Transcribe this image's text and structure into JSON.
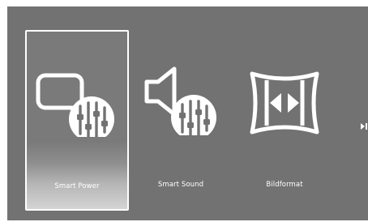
{
  "menu": {
    "items": [
      {
        "label": "Smart Power",
        "icon": "smart-power-icon",
        "selected": true
      },
      {
        "label": "Smart Sound",
        "icon": "smart-sound-icon",
        "selected": false
      },
      {
        "label": "Bildformat",
        "icon": "picture-format-icon",
        "selected": false
      }
    ],
    "next_icon": "next-arrow-icon"
  },
  "colors": {
    "background": "#727272",
    "foreground": "#ffffff",
    "page": "#ffffff"
  }
}
